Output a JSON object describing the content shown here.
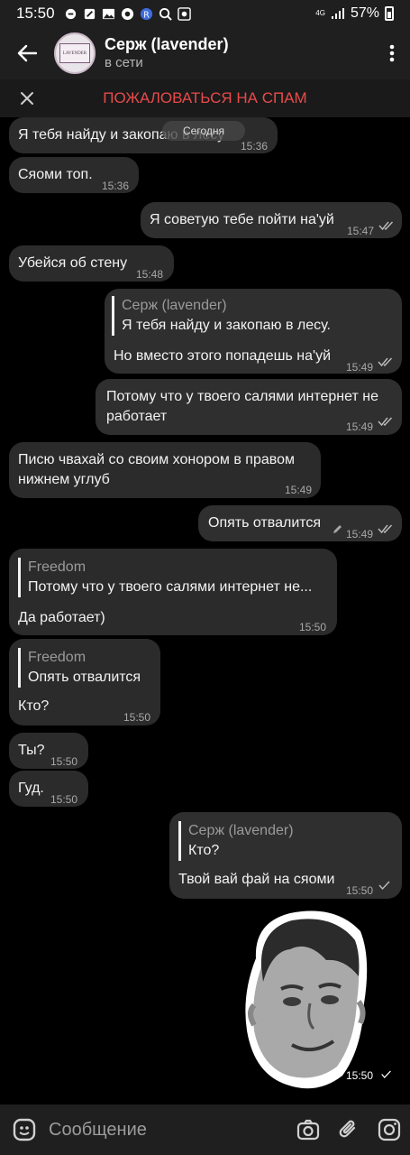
{
  "status_bar": {
    "time": "15:50",
    "network": "4G",
    "battery": "57%"
  },
  "header": {
    "title": "Серж (lavender)",
    "status": "в сети",
    "avatar_text": "LAVENDER"
  },
  "spam_bar": {
    "label": "ПОЖАЛОВАТЬСЯ НА СПАМ"
  },
  "date_pill": "Сегодня",
  "messages": [
    {
      "dir": "in",
      "text": "Я тебя найду и закопаю в лесу",
      "time": "15:36"
    },
    {
      "dir": "in",
      "text": "Сяоми топ.",
      "time": "15:36"
    },
    {
      "dir": "out",
      "text": "Я советую тебе пойти на'уй",
      "time": "15:47",
      "status": "read"
    },
    {
      "dir": "in",
      "text": "Убейся об стену",
      "time": "15:48"
    },
    {
      "dir": "out",
      "reply_name": "Серж (lavender)",
      "reply_text": "Я тебя найду и закопаю в лесу.",
      "text": "Но вместо этого попадешь на'уй",
      "time": "15:49",
      "status": "read"
    },
    {
      "dir": "out",
      "text_lines": [
        "Потому что у твоего салями интернет не",
        "работает"
      ],
      "time": "15:49",
      "status": "read"
    },
    {
      "dir": "in",
      "text_lines": [
        "Писю чвахай со своим хонором в правом",
        "нижнем углуб"
      ],
      "time": "15:49"
    },
    {
      "dir": "out",
      "text": "Опять отвалится",
      "time": "15:49",
      "edited": true,
      "status": "read"
    },
    {
      "dir": "in",
      "reply_name": "Freedom",
      "reply_text": "Потому что у твоего салями интернет не...",
      "text": "Да работает)",
      "time": "15:50"
    },
    {
      "dir": "in",
      "reply_name": "Freedom",
      "reply_text": "Опять отвалится",
      "text": "Кто?",
      "time": "15:50"
    },
    {
      "dir": "in",
      "text": "Ты?",
      "time": "15:50"
    },
    {
      "dir": "in",
      "text": "Гуд.",
      "time": "15:50"
    },
    {
      "dir": "out",
      "reply_name": "Серж (lavender)",
      "reply_text": "Кто?",
      "text": "Твой вай фай на сяоми",
      "time": "15:50",
      "status": "sent"
    }
  ],
  "sticker": {
    "time": "15:50",
    "status": "sent"
  },
  "input": {
    "placeholder": "Сообщение"
  },
  "colors": {
    "background": "#000000",
    "bubble": "#2b2b2b",
    "bar": "#1f1f1f",
    "spam": "#e84a4a",
    "muted": "#9a9a9a"
  },
  "icons": [
    "back-arrow-icon",
    "more-vert-icon",
    "close-icon",
    "emoji-icon",
    "camera-icon",
    "attach-icon",
    "instagram-icon",
    "double-check-icon",
    "single-check-icon",
    "pencil-icon"
  ]
}
